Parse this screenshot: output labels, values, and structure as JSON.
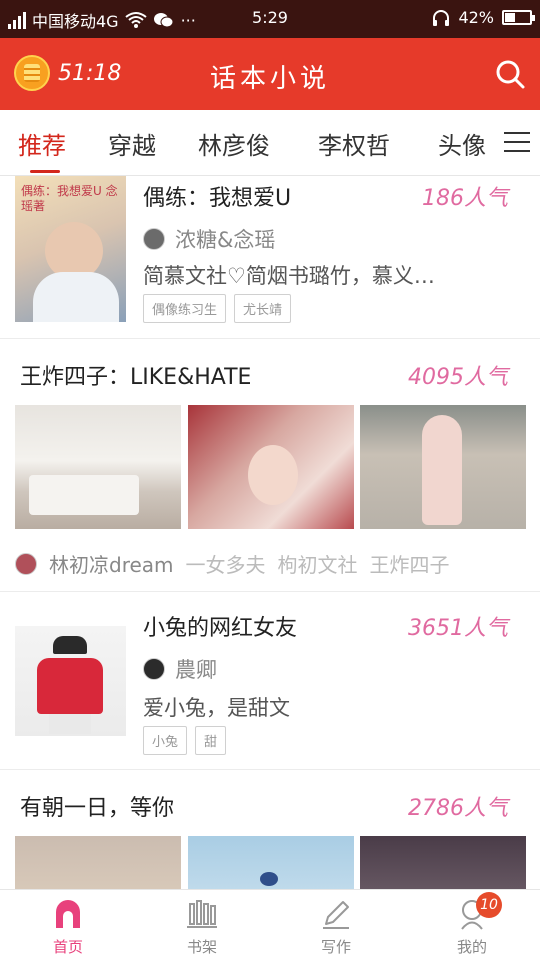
{
  "status_bar": {
    "carrier": "中国移动4G",
    "dots": "···",
    "time": "5:29",
    "battery": "42%",
    "battery_level": 0.42
  },
  "header": {
    "timer": "51:18",
    "title": "话本小说"
  },
  "tabs": [
    {
      "label": "推荐",
      "active": true
    },
    {
      "label": "穿越",
      "active": false
    },
    {
      "label": "林彦俊",
      "active": false
    },
    {
      "label": "李权哲",
      "active": false
    },
    {
      "label": "头像",
      "active": false
    }
  ],
  "feed": {
    "card1": {
      "title": "偶练：我想爱U",
      "popularity": "186人气",
      "cover_text": "偶练：我想爱U 念瑶著",
      "author": "浓糖&念瑶",
      "description": "简慕文社♡简烟书璐竹，慕义…",
      "tags": [
        "偶像练习生",
        "尤长靖"
      ]
    },
    "card2": {
      "title": "王炸四子：LIKE&HATE",
      "popularity": "4095人气",
      "author": "林初凉dream",
      "tags": [
        "一女多夫",
        "枸初文社",
        "王炸四子"
      ]
    },
    "card3": {
      "title": "小兔的网红女友",
      "popularity": "3651人气",
      "author": "農卿",
      "description": "爱小兔，是甜文",
      "tags": [
        "小兔",
        "甜"
      ]
    },
    "card4": {
      "title": "有朝一日，等你",
      "popularity": "2786人气"
    }
  },
  "bottom_nav": [
    {
      "label": "首页",
      "icon": "home-icon",
      "active": true
    },
    {
      "label": "书架",
      "icon": "bookshelf-icon",
      "active": false
    },
    {
      "label": "写作",
      "icon": "pen-icon",
      "active": false
    },
    {
      "label": "我的",
      "icon": "profile-icon",
      "active": false,
      "badge": "10"
    }
  ],
  "colors": {
    "brand_red": "#e63a2a",
    "active_tab": "#d3271c",
    "popularity_pink": "#e06aa0",
    "nav_active": "#e8417c"
  }
}
